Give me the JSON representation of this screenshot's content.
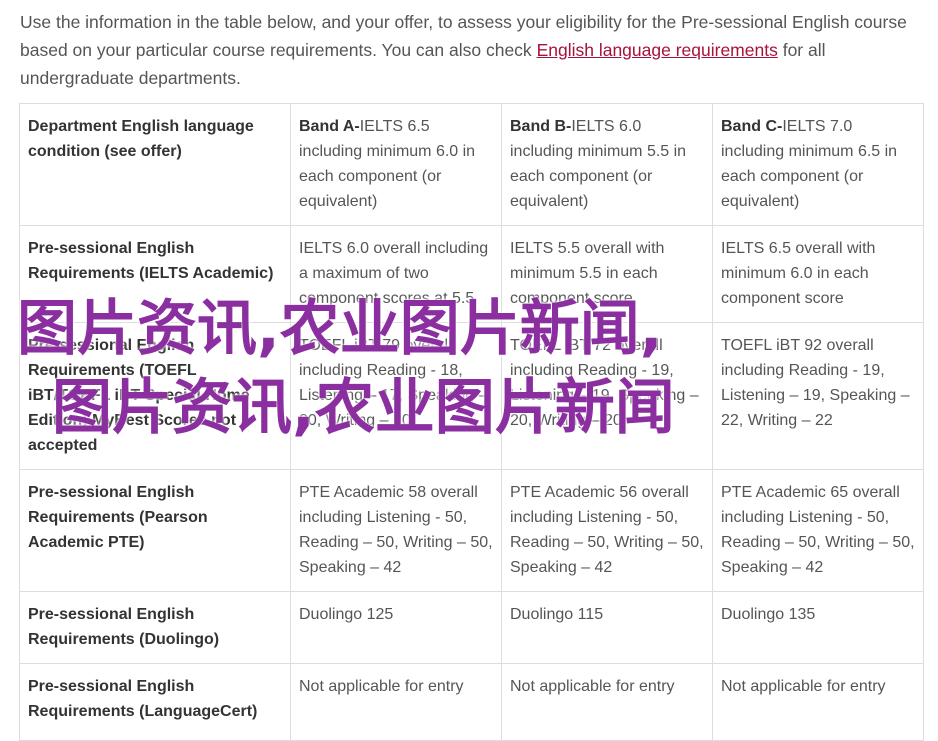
{
  "intro": {
    "text_before": "Use the information in the table below, and your offer, to assess your eligibility for the Pre-sessional English course based on your particular course requirements. You can also check ",
    "link": "English language requirements",
    "text_after": " for all undergraduate departments."
  },
  "table": {
    "header": {
      "condition": "Department English language condition (see offer)",
      "bands": [
        {
          "name": "Band A-",
          "detail": "IELTS 6.5 including minimum 6.0 in each component (or equivalent)"
        },
        {
          "name": "Band B-",
          "detail": "IELTS 6.0 including minimum 5.5 in each component (or equivalent)"
        },
        {
          "name": "Band C-",
          "detail": "IELTS 7.0 including minimum 6.5 in each component (or equivalent)"
        }
      ]
    },
    "rows": [
      {
        "label": "Pre-sessional English Requirements (IELTS Academic)",
        "cells": [
          "IELTS 6.0 overall including a maximum of two component scores at 5.5",
          "IELTS 5.5 overall with minimum 5.5 in each component score",
          "IELTS 6.5 overall with minimum 6.0 in each component score"
        ]
      },
      {
        "label": "Pre-sessional English Requirements (TOEFL iBT/TOEFL iBT Special Home Edition) MyBest Scores not accepted",
        "cells": [
          "TOEFL iBT 79 overall including Reading - 18, Listening – 17, Speaking – 20, Writing – 20",
          "TOEFL iBT 72 overall including Reading - 19, Listening – 19, Speaking – 20, Writing – 20",
          "TOEFL iBT 92 overall including Reading - 19, Listening – 19, Speaking – 22, Writing – 22"
        ]
      },
      {
        "label": "Pre-sessional English Requirements (Pearson Academic PTE)",
        "cells": [
          "PTE Academic 58 overall including Listening - 50, Reading – 50, Writing – 50, Speaking – 42",
          "PTE Academic 56 overall including Listening - 50, Reading – 50, Writing – 50, Speaking – 42",
          "PTE Academic 65 overall including Listening - 50, Reading – 50, Writing – 50, Speaking – 42"
        ]
      },
      {
        "label": "Pre-sessional English Requirements (Duolingo)",
        "cells": [
          "Duolingo 125",
          "Duolingo 115",
          "Duolingo 135"
        ]
      },
      {
        "label": "Pre-sessional English Requirements (LanguageCert)",
        "cells": [
          "Not applicable for entry",
          "Not applicable for entry",
          "Not applicable for entry"
        ]
      }
    ]
  },
  "watermark": {
    "line1": "图片资讯,农业图片新闻,",
    "line2": "图片资讯,农业图片新闻",
    "color": "#8b2fa0"
  },
  "colors": {
    "link": "#a8123a",
    "text": "#555555",
    "border": "#dddddd"
  }
}
